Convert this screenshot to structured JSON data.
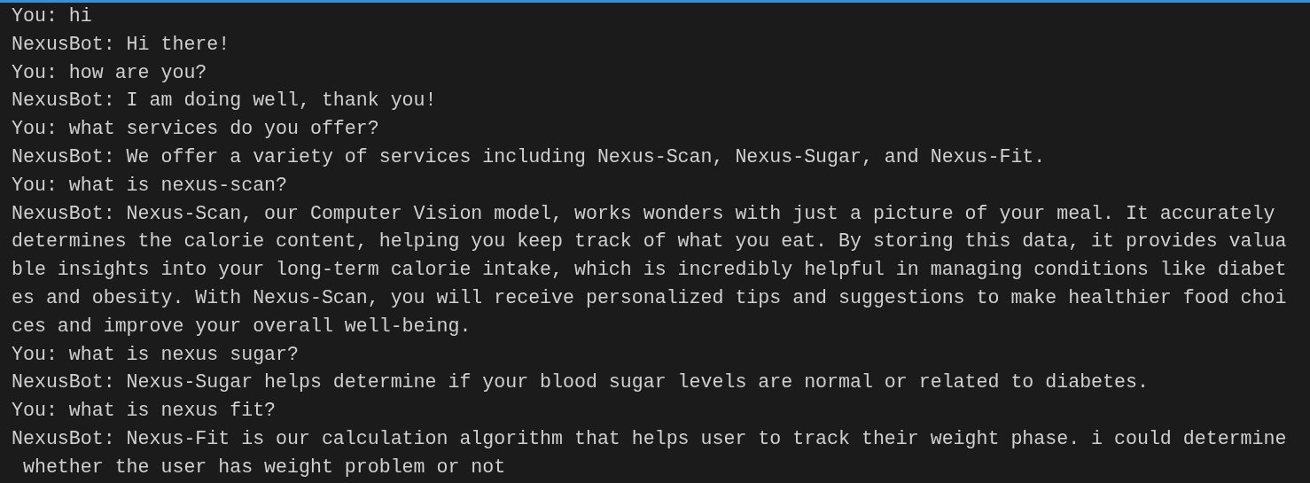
{
  "terminal": {
    "lines": [
      "You: hi",
      "NexusBot: Hi there!",
      "You: how are you?",
      "NexusBot: I am doing well, thank you!",
      "You: what services do you offer?",
      "NexusBot: We offer a variety of services including Nexus-Scan, Nexus-Sugar, and Nexus-Fit.",
      "You: what is nexus-scan?",
      "NexusBot: Nexus-Scan, our Computer Vision model, works wonders with just a picture of your meal. It accurately",
      "determines the calorie content, helping you keep track of what you eat. By storing this data, it provides valua",
      "ble insights into your long-term calorie intake, which is incredibly helpful in managing conditions like diabet",
      "es and obesity. With Nexus-Scan, you will receive personalized tips and suggestions to make healthier food choi",
      "ces and improve your overall well-being.",
      "You: what is nexus sugar?",
      "NexusBot: Nexus-Sugar helps determine if your blood sugar levels are normal or related to diabetes.",
      "You: what is nexus fit?",
      "NexusBot: Nexus-Fit is our calculation algorithm that helps user to track their weight phase. i could determine",
      " whether the user has weight problem or not"
    ]
  }
}
